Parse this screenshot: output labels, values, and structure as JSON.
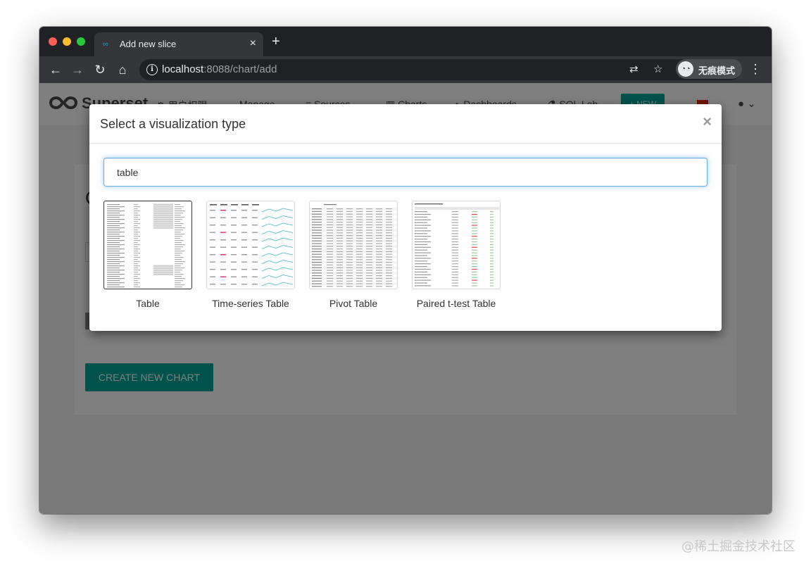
{
  "browser": {
    "tab_title": "Add new slice",
    "tab_close": "×",
    "new_tab": "+",
    "url_host": "localhost",
    "url_path": ":8088/chart/add",
    "incognito_label": "无痕模式",
    "nav_icons": [
      "back-arrow-icon",
      "forward-arrow-icon",
      "reload-icon",
      "home-icon",
      "info-icon",
      "translate-icon",
      "star-icon",
      "incognito-icon",
      "kebab-menu-icon"
    ]
  },
  "app": {
    "logo": "Superset",
    "nav": [
      {
        "label": "用户权限",
        "icon": "users-icon"
      },
      {
        "label": "Manage",
        "icon": "chevron-down-icon"
      },
      {
        "label": "Sources",
        "icon": "database-icon"
      },
      {
        "label": "Charts",
        "icon": "bar-chart-icon"
      },
      {
        "label": "Dashboards",
        "icon": "dashboard-icon"
      },
      {
        "label": "SQL Lab",
        "icon": "flask-icon"
      }
    ],
    "new_button": "+ NEW",
    "create_button": "CREATE NEW CHART",
    "accent_color": "#00a699"
  },
  "modal": {
    "title": "Select a visualization type",
    "close": "×",
    "search_value": "table",
    "visualizations": [
      {
        "label": "Table",
        "selected": true
      },
      {
        "label": "Time-series Table",
        "selected": false
      },
      {
        "label": "Pivot Table",
        "selected": false
      },
      {
        "label": "Paired t-test Table",
        "selected": false
      }
    ]
  },
  "watermark": "@稀土掘金技术社区"
}
